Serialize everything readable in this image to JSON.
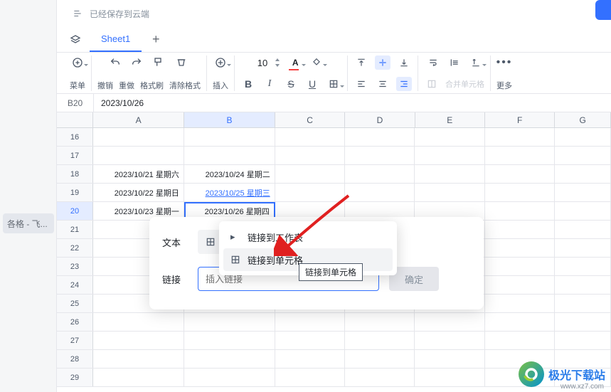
{
  "header": {
    "saved_status": "已经保存到云端"
  },
  "left_panel": {
    "item_label": "各格 - 飞..."
  },
  "tabs": {
    "active": "Sheet1"
  },
  "toolbar": {
    "menu_label": "菜单",
    "undo_label": "撤销",
    "redo_label": "重做",
    "format_painter_label": "格式刷",
    "clear_format_label": "清除格式",
    "insert_label": "插入",
    "font_size": "10",
    "bold": "B",
    "italic": "I",
    "strike": "S",
    "underline": "U",
    "merge_label": "合并单元格",
    "more_label": "更多"
  },
  "formula_bar": {
    "cell_ref": "B20",
    "cell_value": "2023/10/26"
  },
  "columns": [
    "A",
    "B",
    "C",
    "D",
    "E",
    "F",
    "G"
  ],
  "rows": [
    {
      "num": "16",
      "a": "",
      "b": ""
    },
    {
      "num": "17",
      "a": "",
      "b": ""
    },
    {
      "num": "18",
      "a": "2023/10/21 星期六",
      "b": "2023/10/24 星期二"
    },
    {
      "num": "19",
      "a": "2023/10/22 星期日",
      "b": "2023/10/25 星期三",
      "b_link": true
    },
    {
      "num": "20",
      "a": "2023/10/23 星期一",
      "b": "2023/10/26 星期四",
      "active": true
    },
    {
      "num": "21",
      "a": "",
      "b": ""
    },
    {
      "num": "22",
      "a": "",
      "b": ""
    },
    {
      "num": "23",
      "a": "",
      "b": ""
    },
    {
      "num": "24",
      "a": "",
      "b": ""
    },
    {
      "num": "25",
      "a": "",
      "b": ""
    },
    {
      "num": "26",
      "a": "",
      "b": ""
    },
    {
      "num": "27",
      "a": "",
      "b": ""
    },
    {
      "num": "28",
      "a": "",
      "b": ""
    },
    {
      "num": "29",
      "a": "",
      "b": ""
    }
  ],
  "popup": {
    "text_label": "文本",
    "link_label": "链接",
    "link_placeholder": "插入链接",
    "confirm_label": "确定"
  },
  "dropdown": {
    "option_sheet": "链接到工作表",
    "option_cell": "链接到单元格"
  },
  "tooltip": {
    "text": "链接到单元格"
  },
  "watermark": {
    "brand": "极光下载站",
    "url": "www.xz7.com"
  }
}
